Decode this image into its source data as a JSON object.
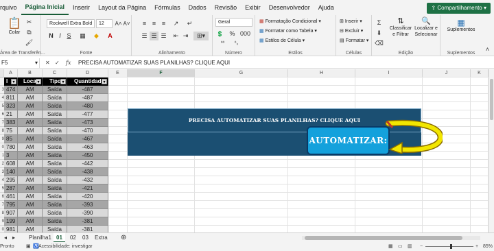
{
  "menu": {
    "items": [
      "rquivo",
      "Página Inicial",
      "Inserir",
      "Layout da Página",
      "Fórmulas",
      "Dados",
      "Revisão",
      "Exibir",
      "Desenvolvedor",
      "Ajuda"
    ],
    "share_label": "Compartilhamento"
  },
  "ribbon": {
    "paste_label": "Colar",
    "clipboard_label": "Área de Transferên...",
    "font_name": "Rockwell Extra Bold",
    "font_size": "12",
    "font_group_label": "Fonte",
    "alignment_label": "Alinhamento",
    "number_format": "Geral",
    "number_label": "Número",
    "cond_format": "Formatação Condicional",
    "format_table": "Formatar como Tabela",
    "cell_styles": "Estilos de Célula",
    "styles_label": "Estilos",
    "insert": "Inserir",
    "delete": "Excluir",
    "format": "Formatar",
    "cells_label": "Células",
    "sort_filter": "Classificar e Filtrar",
    "find_select": "Localizar e Selecionar",
    "editing_label": "Edição",
    "addins": "Suplementos",
    "addins_label": "Suplementos"
  },
  "formula_bar": {
    "name_box": "F5",
    "fx": "fx",
    "content": "PRECISA AUTOMATIZAR SUAS PLANILHAS? CLIQUE AQUI"
  },
  "columns": [
    "A",
    "B",
    "C",
    "D",
    "E",
    "F",
    "G",
    "H",
    "I",
    "J",
    "K"
  ],
  "table": {
    "headers": [
      "I",
      "Local",
      "Tipo",
      "Quantidade"
    ],
    "rows": [
      [
        "474",
        "AM",
        "Saída",
        "-487"
      ],
      [
        "811",
        "AM",
        "Saída",
        "-487"
      ],
      [
        "323",
        "AM",
        "Saída",
        "-480"
      ],
      [
        "21",
        "AM",
        "Saída",
        "-477"
      ],
      [
        "383",
        "AM",
        "Saída",
        "-473"
      ],
      [
        "75",
        "AM",
        "Saída",
        "-470"
      ],
      [
        "85",
        "AM",
        "Saída",
        "-467"
      ],
      [
        "780",
        "AM",
        "Saída",
        "-463"
      ],
      [
        "3",
        "AM",
        "Saída",
        "-450"
      ],
      [
        "608",
        "AM",
        "Saída",
        "-442"
      ],
      [
        "140",
        "AM",
        "Saída",
        "-438"
      ],
      [
        "295",
        "AM",
        "Saída",
        "-432"
      ],
      [
        "287",
        "AM",
        "Saída",
        "-421"
      ],
      [
        "461",
        "AM",
        "Saída",
        "-420"
      ],
      [
        "795",
        "AM",
        "Saída",
        "-393"
      ],
      [
        "907",
        "AM",
        "Saída",
        "-390"
      ],
      [
        "199",
        "AM",
        "Saída",
        "-381"
      ],
      [
        "981",
        "AM",
        "Saída",
        "-381"
      ],
      [
        "64",
        "AM",
        "Saída",
        "-370"
      ]
    ],
    "row_numbers": [
      "",
      "3",
      "4",
      "5",
      "6",
      "7",
      "8",
      "9",
      "0",
      "1",
      "2",
      "3",
      "4",
      "5",
      "6",
      "7",
      "8",
      "9",
      "0"
    ]
  },
  "banner": {
    "title": "PRECISA AUTOMATIZAR SUAS PLANILHAS? CLIQUE AQUI",
    "button": "AUTOMATIZAR:"
  },
  "sheets": [
    "Planilha1",
    "01",
    "02",
    "03",
    "Extra"
  ],
  "status": {
    "mode": "Pronto",
    "accessibility": "Acessibilidade: investigar",
    "zoom": "85%"
  }
}
